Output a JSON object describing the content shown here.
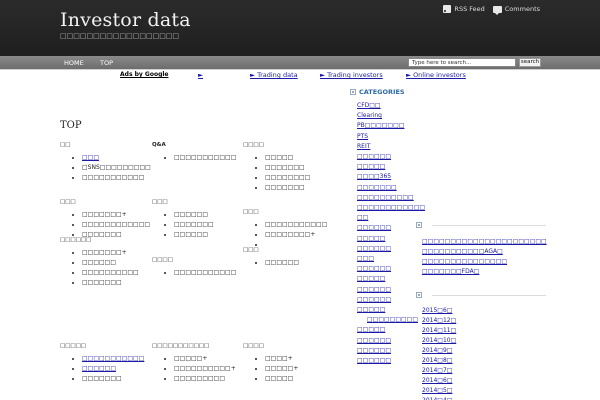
{
  "header": {
    "title": "Investor data",
    "tagline": "□□□□□□□□□□□□□□□□□□",
    "rss_label": "RSS Feed",
    "comments_label": "Comments"
  },
  "nav": {
    "items": [
      "HOME",
      "TOP"
    ],
    "search_placeholder": "Type here to search...",
    "search_button": "search"
  },
  "ads": {
    "label": "Ads by Google",
    "links": [
      "►    ",
      "► Trading data",
      "► Trading investors",
      "► Online investors"
    ]
  },
  "main": {
    "page_title": "TOP",
    "blocks": [
      {
        "title": "□□",
        "items": [
          {
            "text": "□□□",
            "link": true
          },
          {
            "text": "□SNS□□□□□□□□□",
            "link": false
          },
          {
            "text": "□□□□□□□□□□□",
            "link": false
          }
        ]
      },
      {
        "title": "Q&A",
        "items": [
          {
            "text": "□□□□□□□□□□□",
            "link": false
          }
        ]
      },
      {
        "title": "□□□□",
        "items": [
          {
            "text": "□□□□□",
            "link": false
          },
          {
            "text": "□□□□□□□",
            "link": false
          },
          {
            "text": "□□□□□□□□",
            "link": false
          },
          {
            "text": "□□□□□□□",
            "link": false
          }
        ]
      },
      {
        "title": "□□□",
        "items": [
          {
            "text": "□□□□□□□+",
            "link": false
          },
          {
            "text": "□□□□□□□□□□□□",
            "link": false
          },
          {
            "text": "□□□□□□□",
            "link": false
          }
        ]
      },
      {
        "title": "□□□",
        "items": [
          {
            "text": "□□□□□□",
            "link": false
          },
          {
            "text": "□□□□□□□",
            "link": false
          },
          {
            "text": "□□□□□□",
            "link": false
          }
        ]
      },
      {
        "title": "□□□",
        "items": [
          {
            "text": "□□□□□□□□□□□",
            "link": false
          },
          {
            "text": "□□□□□□□□+",
            "link": false
          },
          {
            "text": "",
            "link": false
          }
        ]
      },
      {
        "title": "□□□□□□",
        "items": [
          {
            "text": "□□□□□□□+",
            "link": false
          },
          {
            "text": "□□□□□□",
            "link": false
          },
          {
            "text": "□□□□□□□□□□",
            "link": false
          },
          {
            "text": "□□□□□□□",
            "link": false
          }
        ]
      },
      {
        "title": "□□□□",
        "items": [
          {
            "text": "□□□□□□□□□□□",
            "link": false
          }
        ]
      },
      {
        "title": "□□□",
        "items": [
          {
            "text": "□□□□□□",
            "link": false
          }
        ]
      },
      {
        "title": "□□□□□",
        "items": [
          {
            "text": "□□□□□□□□□□□",
            "link": true
          },
          {
            "text": "□□□□□□",
            "link": true
          },
          {
            "text": "□□□□□□□",
            "link": false
          }
        ]
      },
      {
        "title": "□□□□□□□□□□□",
        "items": [
          {
            "text": "□□□□□+",
            "link": false
          },
          {
            "text": "□□□□□□□□□□+",
            "link": false
          },
          {
            "text": "□□□□□□□□□",
            "link": false
          }
        ]
      },
      {
        "title": "□□□□",
        "items": [
          {
            "text": "□□□□+",
            "link": false
          },
          {
            "text": "□□□□□+",
            "link": false
          },
          {
            "text": "□□□□□",
            "link": false
          }
        ]
      }
    ]
  },
  "sidebar": {
    "categories_title": "CATEGORIES",
    "categories": [
      {
        "text": "CFD□□",
        "sub": false
      },
      {
        "text": "Clearing",
        "sub": false
      },
      {
        "text": "PB□□□□□□□",
        "sub": false
      },
      {
        "text": "PTS",
        "sub": false
      },
      {
        "text": "REIT",
        "sub": false
      },
      {
        "text": "□□□□□□",
        "sub": false
      },
      {
        "text": "□□□□□",
        "sub": false
      },
      {
        "text": "□□□□365",
        "sub": false
      },
      {
        "text": "□□□□□□□",
        "sub": false
      },
      {
        "text": "□□□□□□□□□□",
        "sub": false
      },
      {
        "text": "□□□□□□□□□□□□",
        "sub": false
      },
      {
        "text": "□□",
        "sub": false
      },
      {
        "text": "□□□□□□",
        "sub": false
      },
      {
        "text": "□□□□□",
        "sub": false
      },
      {
        "text": "□□□□□□",
        "sub": false
      },
      {
        "text": "□□□",
        "sub": false
      },
      {
        "text": "□□□□□□",
        "sub": false
      },
      {
        "text": "□□□□□",
        "sub": false
      },
      {
        "text": "□□□□□□",
        "sub": false
      },
      {
        "text": "□□□□□□",
        "sub": false
      },
      {
        "text": "□□□□□",
        "sub": false
      },
      {
        "text": "□□□□□□□□□",
        "sub": true
      },
      {
        "text": "□□□□□",
        "sub": false
      },
      {
        "text": "□□□□□□",
        "sub": false
      },
      {
        "text": "□□□□□□",
        "sub": false
      },
      {
        "text": "□□□□□□",
        "sub": false
      }
    ],
    "recent": [
      "□□□□□□□□□□□□□□□□□□□□□□",
      "□□□□□□□□□□□AGA□",
      "□□□□□□□□□□□□□□□",
      "□□□□□□□FDA□"
    ],
    "archives": [
      "2015□6□",
      "2014□12□",
      "2014□11□",
      "2014□10□",
      "2014□9□",
      "2014□8□",
      "2014□7□",
      "2014□6□",
      "2014□5□",
      "2014□4□"
    ]
  }
}
